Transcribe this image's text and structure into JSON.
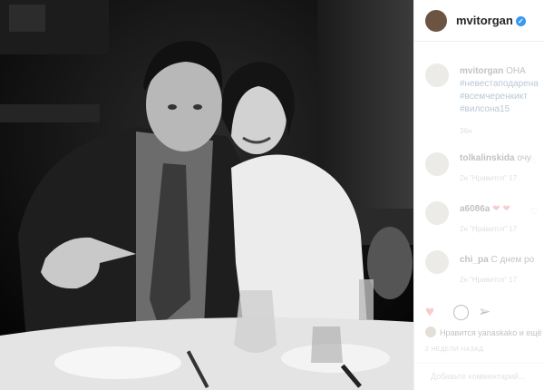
{
  "post": {
    "username": "mvitorgan",
    "verified_badge": "✓"
  },
  "caption": {
    "username": "mvitorgan",
    "lines": [
      "ОНА",
      "#невестаподарена",
      "#всемчеренкикт",
      "#вилсона15"
    ],
    "time": "36н"
  },
  "comments": [
    {
      "username": "tolkalinskida",
      "text": "очу",
      "meta": "2н  \"Нравится\" 17"
    },
    {
      "username": "a6086a",
      "text": "❤ ❤",
      "meta": "2н  \"Нравится\" 17"
    },
    {
      "username": "chi_pa",
      "text": "С днем ро",
      "meta": "2н  \"Нравится\" 17"
    }
  ],
  "actions": {
    "like_icon": "heart-icon",
    "comment_icon": "comment-icon",
    "share_icon": "share-icon"
  },
  "likes": {
    "text": "Нравится yanaskako и ещё"
  },
  "timeago": "2 НЕДЕЛИ НАЗАД",
  "add_comment": {
    "placeholder": "Добавьте комментарий..."
  }
}
